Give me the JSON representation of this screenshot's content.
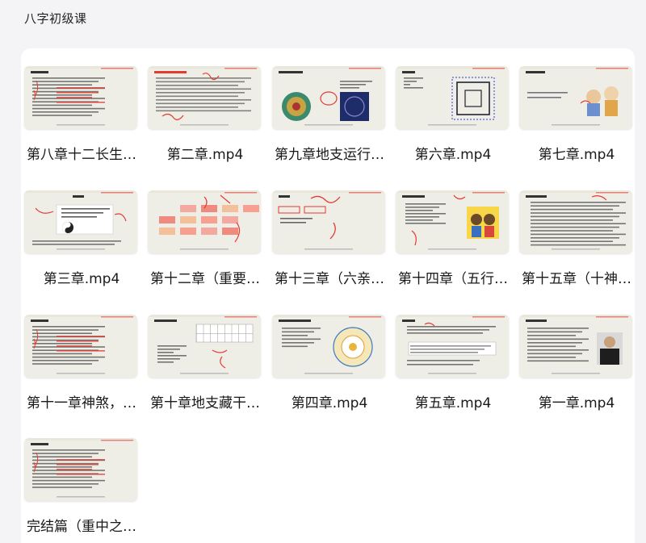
{
  "page": {
    "title": "八字初级课"
  },
  "files": [
    {
      "name": "第八章十二长生…",
      "thumb": "slide-text-red"
    },
    {
      "name": "第二章.mp4",
      "thumb": "slide-text-handwriting"
    },
    {
      "name": "第九章地支运行…",
      "thumb": "slide-two-images"
    },
    {
      "name": "第六章.mp4",
      "thumb": "slide-square-diagram"
    },
    {
      "name": "第七章.mp4",
      "thumb": "slide-cartoon-people"
    },
    {
      "name": "第三章.mp4",
      "thumb": "slide-taiji"
    },
    {
      "name": "第十二章（重要…",
      "thumb": "slide-red-boxes"
    },
    {
      "name": "第十三章（六亲…",
      "thumb": "slide-handwriting"
    },
    {
      "name": "第十四章（五行…",
      "thumb": "slide-kids-cartoon"
    },
    {
      "name": "第十五章（十神…",
      "thumb": "slide-dense-text"
    },
    {
      "name": "第十一章神煞，…",
      "thumb": "slide-text-red"
    },
    {
      "name": "第十章地支藏干…",
      "thumb": "slide-table"
    },
    {
      "name": "第四章.mp4",
      "thumb": "slide-wheel"
    },
    {
      "name": "第五章.mp4",
      "thumb": "slide-text-table"
    },
    {
      "name": "第一章.mp4",
      "thumb": "slide-portrait"
    },
    {
      "name": "完结篇（重中之…",
      "thumb": "slide-text-red"
    }
  ],
  "colors": {
    "accent_red": "#e23b32",
    "thumb_bg": "#efeee6"
  }
}
